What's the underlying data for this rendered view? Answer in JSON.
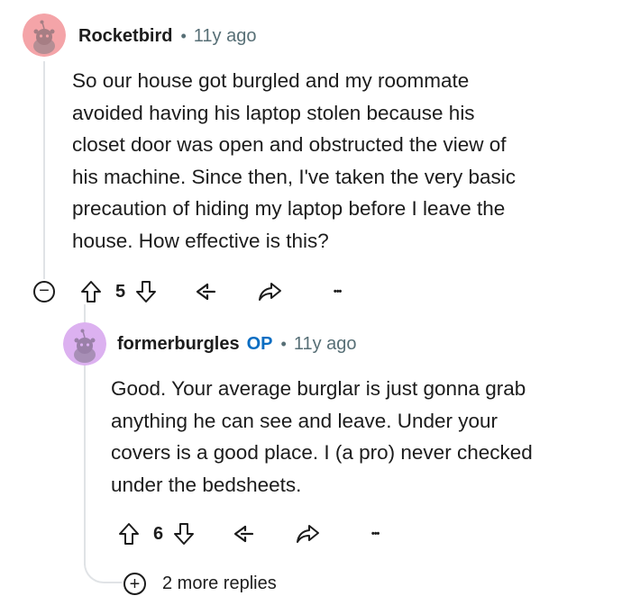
{
  "comment": {
    "author": "Rocketbird",
    "separator": "•",
    "time": "11y ago",
    "avatar_color": "#f4a4a8",
    "lines": [
      "So our house got burgled and my roommate",
      "avoided having his laptop stolen because his",
      "closet door was open and obstructed the view of",
      "his machine. Since then, I've taken the very basic",
      "precaution of hiding my laptop before I leave the",
      "house. How effective is this?"
    ],
    "score": "5",
    "collapse_symbol": "−",
    "more_symbol": "•••"
  },
  "reply": {
    "author": "formerburgles",
    "op_badge": "OP",
    "op_color": "#0a6dc2",
    "separator": "•",
    "time": "11y ago",
    "avatar_color": "#dcb1f0",
    "lines": [
      "Good. Your average burglar is just gonna grab",
      "anything he can see and leave. Under your",
      "covers is a good place. I (a pro) never checked",
      "under the bedsheets."
    ],
    "score": "6",
    "more_symbol": "•••"
  },
  "more_replies": {
    "icon": "+",
    "label": "2 more replies"
  },
  "icons": {
    "upvote": "upvote-arrow-icon",
    "downvote": "downvote-arrow-icon",
    "award": "award-icon",
    "share": "share-arrow-icon",
    "more": "more-dots-icon"
  }
}
